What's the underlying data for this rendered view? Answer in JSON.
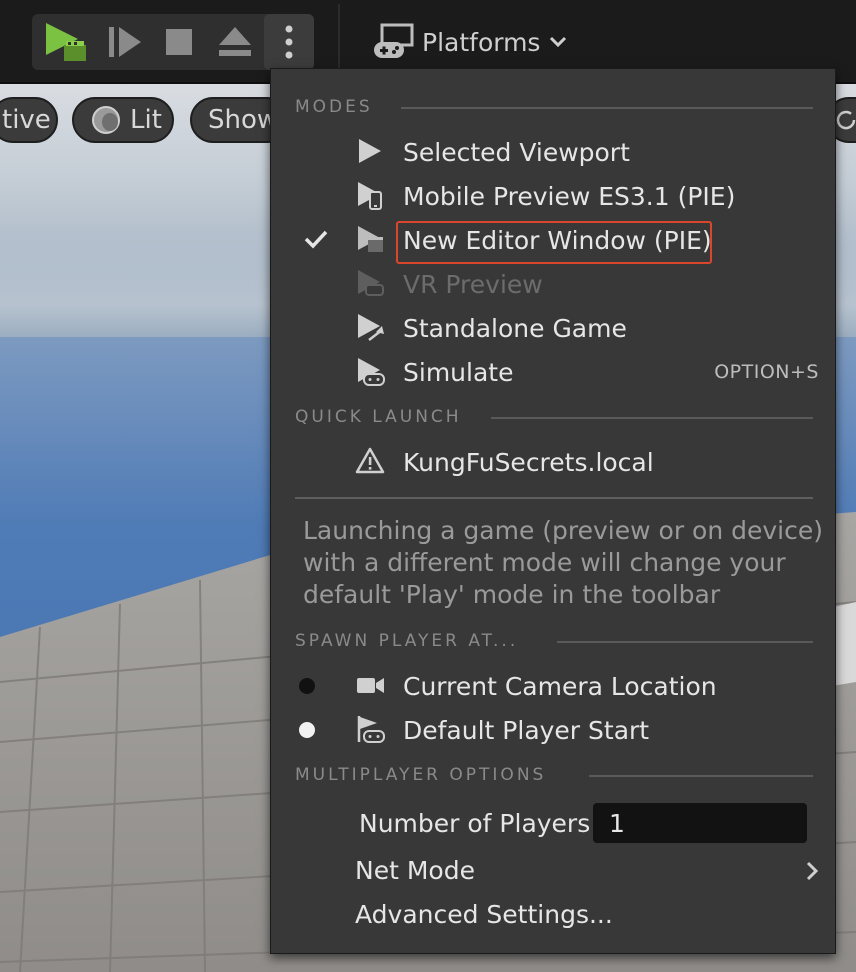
{
  "toolbar": {
    "buttons": [
      {
        "name": "play-icon"
      },
      {
        "name": "frame-skip-icon"
      },
      {
        "name": "stop-icon"
      },
      {
        "name": "eject-icon"
      },
      {
        "name": "more-options-icon"
      }
    ],
    "platforms_label": "Platforms"
  },
  "viewport": {
    "pill_perspective": "tive",
    "pill_lit": "Lit",
    "pill_show": "Show"
  },
  "menu": {
    "modes_title": "MODES",
    "modes": [
      {
        "label": "Selected Viewport",
        "icon": "play-triangle-icon"
      },
      {
        "label": "Mobile Preview ES3.1 (PIE)",
        "icon": "mobile-preview-icon"
      },
      {
        "label": "New Editor Window (PIE)",
        "icon": "editor-window-icon",
        "checked": true,
        "highlighted": true
      },
      {
        "label": "VR Preview",
        "icon": "vr-preview-icon",
        "disabled": true
      },
      {
        "label": "Standalone Game",
        "icon": "standalone-game-icon"
      },
      {
        "label": "Simulate",
        "icon": "simulate-icon",
        "shortcut": "OPTION+S"
      }
    ],
    "quick_launch_title": "QUICK LAUNCH",
    "quick_launch": [
      {
        "label": "KungFuSecrets.local",
        "icon": "warning-icon"
      }
    ],
    "hint": "Launching a game (preview or on device) with a different mode will change your default 'Play' mode in the toolbar",
    "spawn_title": "SPAWN PLAYER AT...",
    "spawn": [
      {
        "label": "Current Camera Location",
        "icon": "camera-icon",
        "selected": false
      },
      {
        "label": "Default Player Start",
        "icon": "player-start-icon",
        "selected": true
      }
    ],
    "multiplayer_title": "MULTIPLAYER OPTIONS",
    "number_of_players_label": "Number of Players",
    "number_of_players_value": "1",
    "net_mode_label": "Net Mode",
    "advanced_label": "Advanced Settings..."
  },
  "colors": {
    "accent_green": "#7cc242",
    "highlight_red": "#d9462b",
    "menu_bg": "#383838"
  }
}
